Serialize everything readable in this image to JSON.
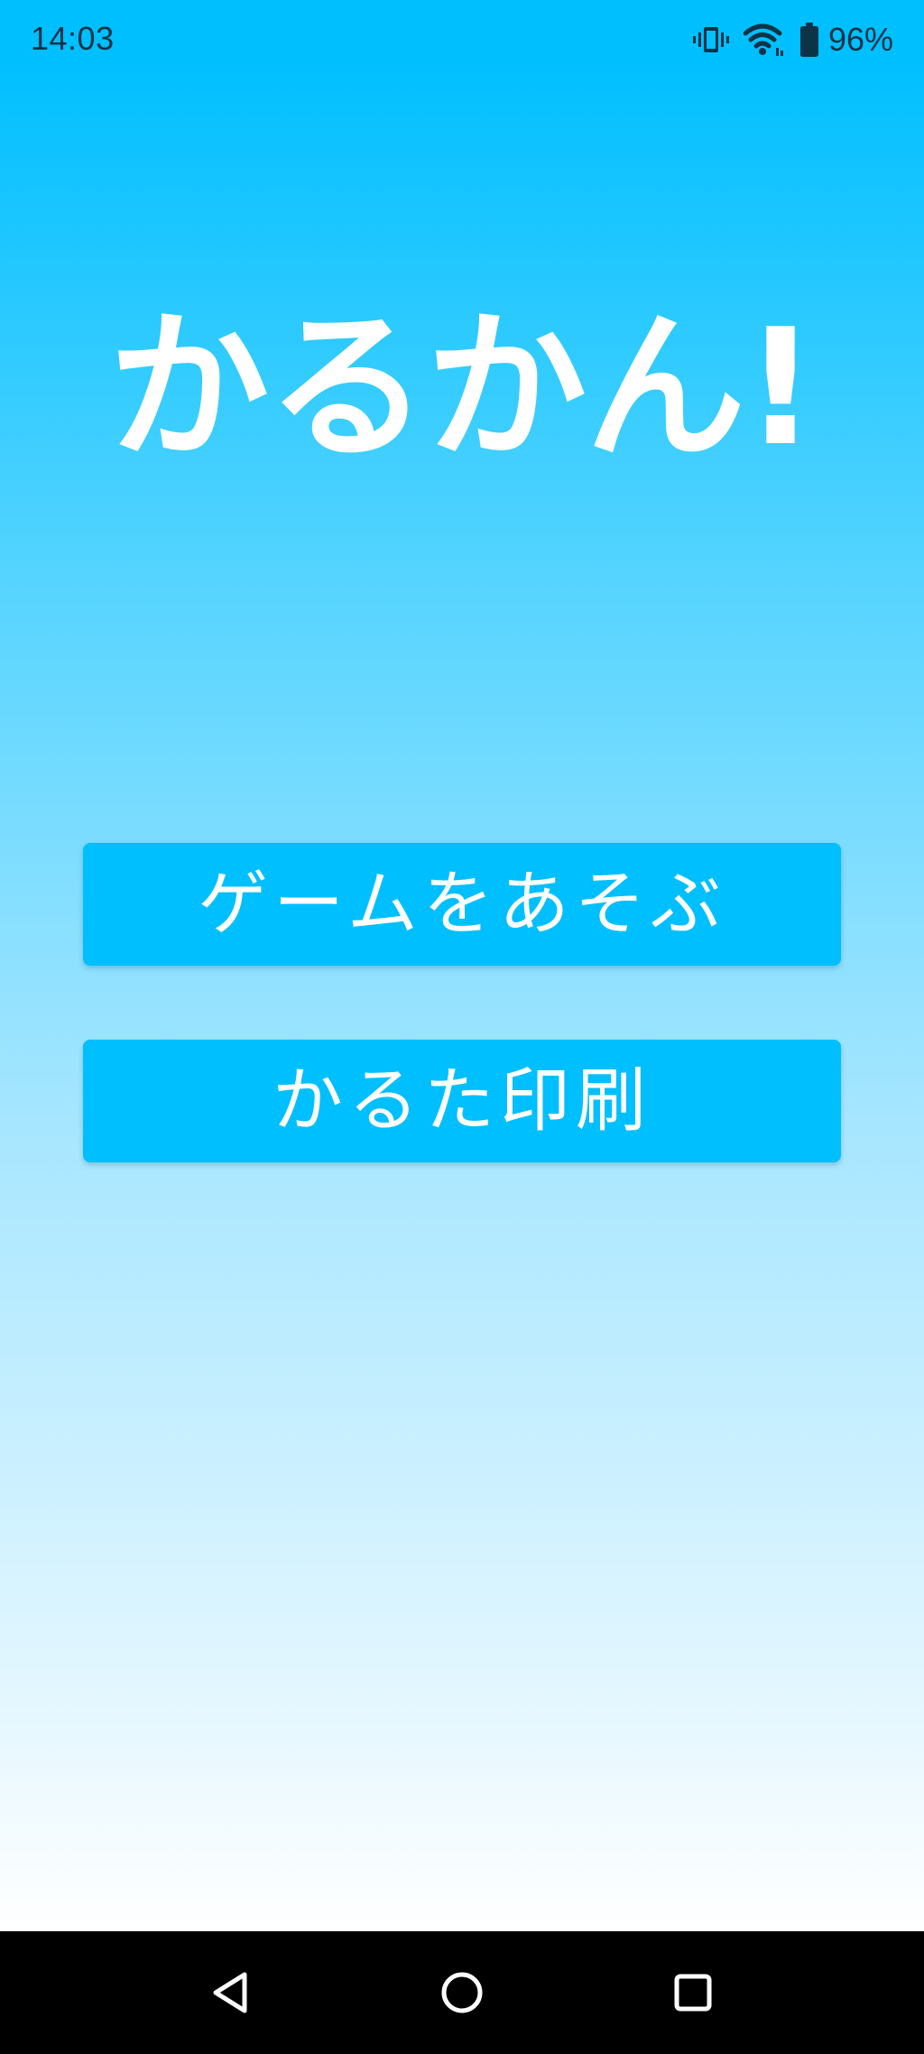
{
  "status_bar": {
    "time": "14:03",
    "battery_percent": "96%",
    "icons": [
      "vibrate-icon",
      "wifi-icon",
      "battery-icon"
    ]
  },
  "app": {
    "title": "かるかん!",
    "buttons": {
      "play_label": "ゲームをあそぶ",
      "print_label": "かるた印刷"
    }
  },
  "nav_bar": {
    "icons": [
      "back-icon",
      "home-icon",
      "recents-icon"
    ]
  },
  "colors": {
    "accent": "#00bfff",
    "text_light": "#ffffff",
    "status_text": "#0d3347",
    "nav_background": "#000000"
  }
}
